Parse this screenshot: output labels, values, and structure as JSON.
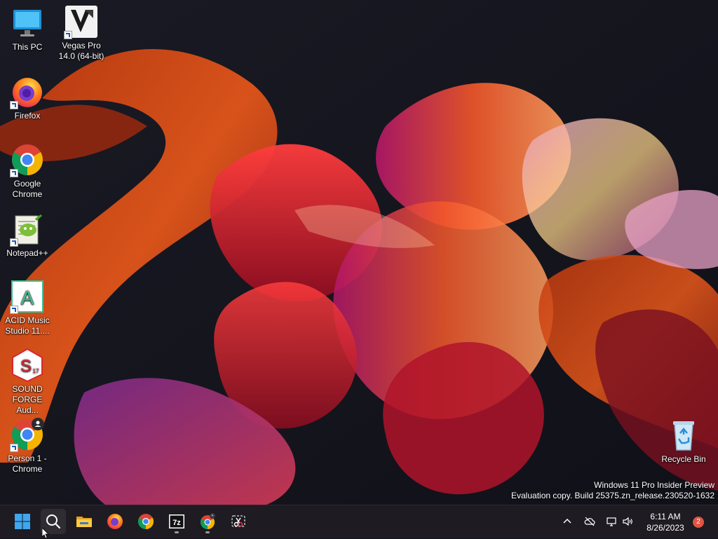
{
  "desktop": {
    "icons": [
      {
        "id": "this-pc",
        "label": "This PC"
      },
      {
        "id": "vegas-pro",
        "label": "Vegas Pro\n14.0 (64-bit)"
      },
      {
        "id": "firefox",
        "label": "Firefox"
      },
      {
        "id": "google-chrome",
        "label": "Google\nChrome"
      },
      {
        "id": "notepad-plus-plus",
        "label": "Notepad++"
      },
      {
        "id": "acid-music-studio",
        "label": "ACID Music\nStudio 11...."
      },
      {
        "id": "sound-forge",
        "label": "SOUND\nFORGE Aud..."
      },
      {
        "id": "person1-chrome",
        "label": "Person 1 -\nChrome"
      },
      {
        "id": "recycle-bin",
        "label": "Recycle Bin"
      }
    ],
    "watermark": {
      "line1": "Windows 11 Pro Insider Preview",
      "line2": "Evaluation copy. Build 25375.zn_release.230520-1632"
    }
  },
  "taskbar": {
    "buttons": [
      {
        "id": "start",
        "icon": "windows-logo-icon"
      },
      {
        "id": "search",
        "icon": "search-icon"
      },
      {
        "id": "file-explorer",
        "icon": "folder-icon"
      },
      {
        "id": "firefox",
        "icon": "firefox-icon"
      },
      {
        "id": "chrome",
        "icon": "chrome-icon"
      },
      {
        "id": "7zip",
        "icon": "7zip-icon",
        "label": "7z"
      },
      {
        "id": "chrome-profile",
        "icon": "chrome-profile-icon"
      },
      {
        "id": "snipping-tool",
        "icon": "snipping-tool-icon"
      }
    ],
    "tray": {
      "icons": [
        "chevron-up-icon",
        "cloud-offline-icon",
        "network-icon",
        "volume-icon"
      ],
      "time": "6:11 AM",
      "date": "8/26/2023",
      "notification_count": "2"
    }
  },
  "colors": {
    "taskbar_bg": "#1e1b22",
    "accent": "#0078d4",
    "notification_badge": "#e05543"
  }
}
